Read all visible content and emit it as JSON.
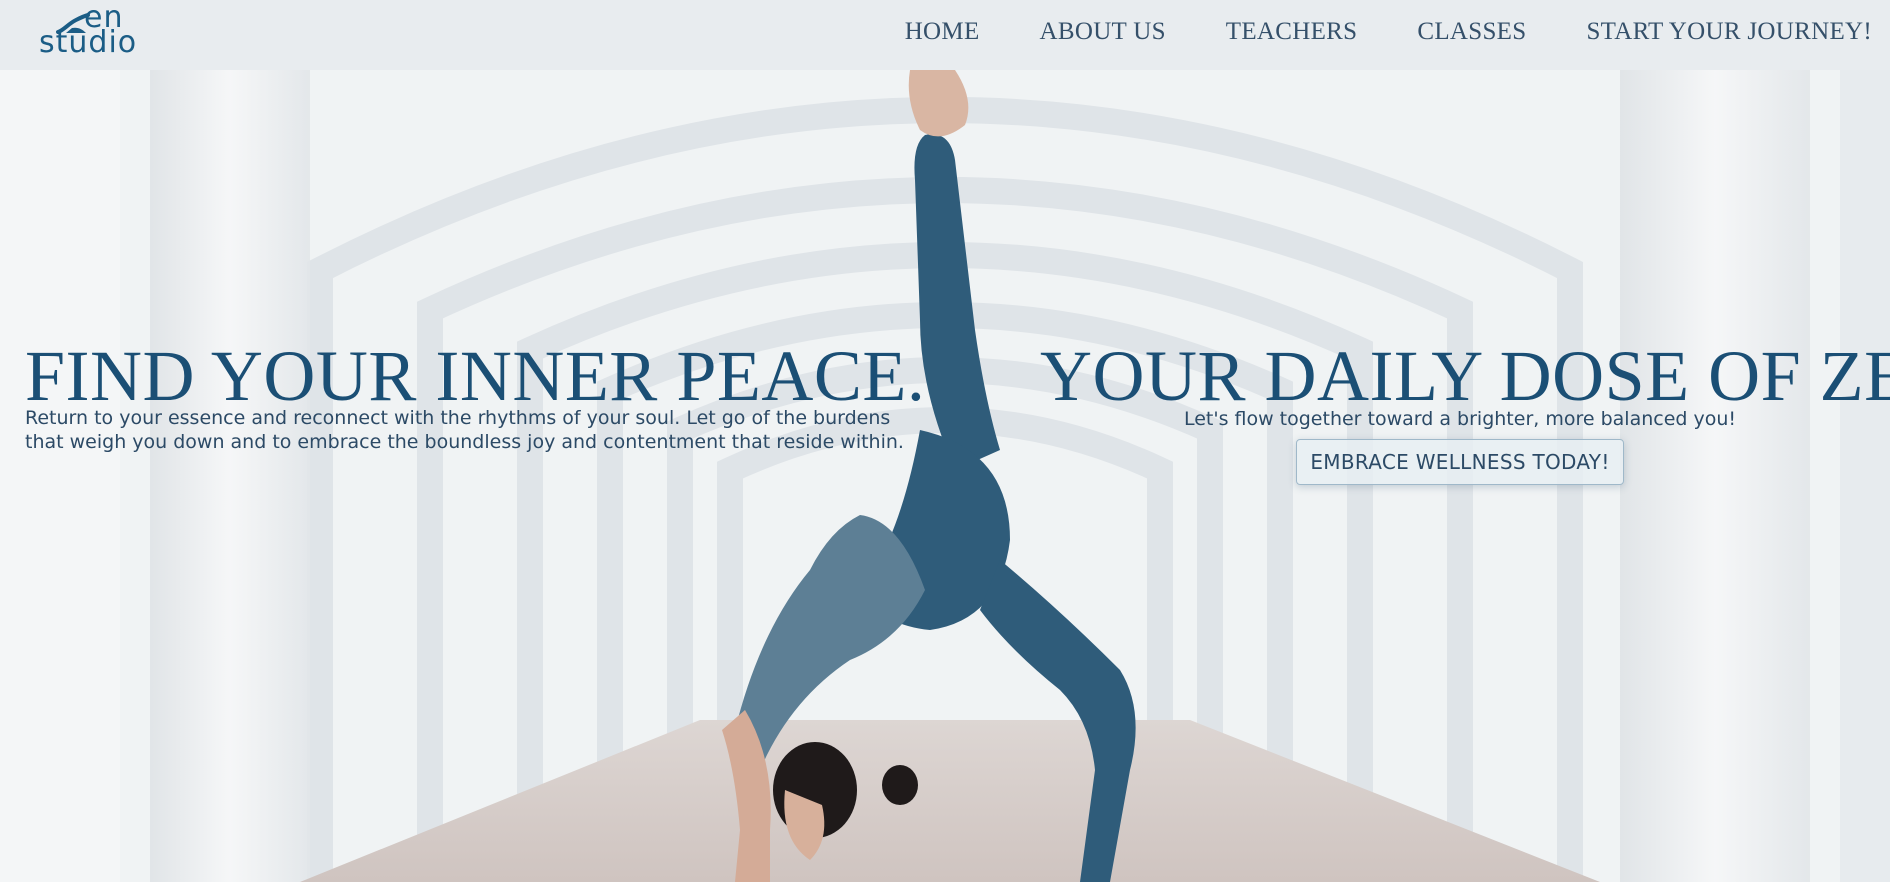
{
  "brand": {
    "logo_top": "en",
    "logo_bottom": "studio",
    "accent_color": "#1b5d86"
  },
  "nav": {
    "items": [
      {
        "label": "HOME"
      },
      {
        "label": "ABOUT US"
      },
      {
        "label": "TEACHERS"
      },
      {
        "label": "CLASSES"
      },
      {
        "label": "START YOUR JOURNEY!"
      }
    ]
  },
  "hero": {
    "left": {
      "headline": "FIND YOUR INNER PEACE.",
      "text": "Return to your essence and reconnect with the rhythms of your soul. Let go of the burdens that weigh you down and to embrace the boundless joy and contentment that reside within."
    },
    "right": {
      "headline": "YOUR DAILY DOSE OF ZEN.",
      "text": "Let's flow together toward a brighter, more balanced you!",
      "cta_label": "EMBRACE WELLNESS TODAY!"
    },
    "image_icon": "yoga-pose-photo",
    "heading_color": "#1b4f75",
    "body_color": "#2c4a66"
  }
}
